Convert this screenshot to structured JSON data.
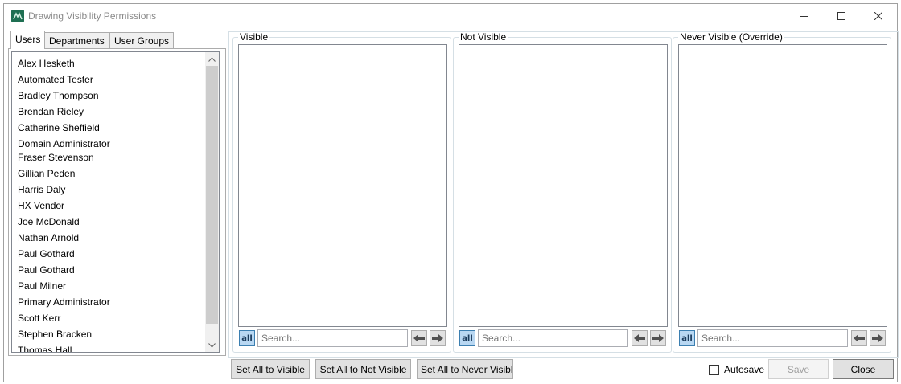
{
  "window": {
    "title": "Drawing Visibility Permissions",
    "minimize": "minimize",
    "maximize": "maximize",
    "close": "close"
  },
  "tabs": [
    {
      "label": "Users",
      "active": true
    },
    {
      "label": "Departments",
      "active": false
    },
    {
      "label": "User Groups",
      "active": false
    }
  ],
  "users": [
    "Alex Hesketh",
    "Automated Tester",
    "Bradley Thompson",
    "Brendan Rieley",
    "Catherine Sheffield",
    "Domain Administrator",
    "Fraser Stevenson",
    "Gillian Peden",
    "Harris Daly",
    "HX Vendor",
    "Joe McDonald",
    "Nathan Arnold",
    "Paul Gothard",
    "Paul Gothard",
    "Paul Milner",
    "Primary Administrator",
    "Scott Kerr",
    "Stephen Bracken",
    "Thomas Hall"
  ],
  "groups": {
    "visible": {
      "title": "Visible",
      "all_label": "all",
      "search_placeholder": "Search..."
    },
    "not_visible": {
      "title": "Not Visible",
      "all_label": "all",
      "search_placeholder": "Search..."
    },
    "never_visible": {
      "title": "Never Visible (Override)",
      "all_label": "all",
      "search_placeholder": "Search..."
    }
  },
  "footer": {
    "set_all_visible": "Set All to Visible",
    "set_all_not_visible": "Set All to Not Visible",
    "set_all_never_visible": "Set All to Never Visible",
    "autosave_label": "Autosave",
    "autosave_checked": false,
    "save": "Save",
    "close": "Close"
  },
  "colors": {
    "accent": "#3c7fb1",
    "app_icon": "#1e6f52"
  }
}
